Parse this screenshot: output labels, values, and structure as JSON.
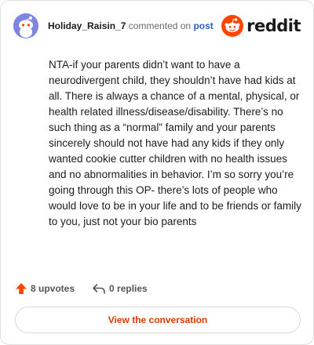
{
  "header": {
    "username": "Holiday_Raisin_7",
    "action_text": "commented on",
    "post_link": "post",
    "brand": "reddit"
  },
  "comment": {
    "body": "NTA-if your parents didn’t want to have a neurodivergent child, they shouldn’t have had kids at all. There is always a chance of a mental, physical, or health related illness/disease/disability. There’s no such thing as a “normal” family and your parents sincerely should not have had any kids if they only wanted cookie cutter children with no health issues and no abnormalities in behavior. I’m so sorry you’re going through this OP- there’s lots of people who would love to be in your life and to be friends or family to you, just not your bio parents"
  },
  "stats": {
    "upvotes": "8 upvotes",
    "replies": "0 replies"
  },
  "cta": {
    "label": "View the conversation"
  },
  "colors": {
    "accent": "#d93a00",
    "upvote": "#ff4500",
    "link": "#2e5fc7",
    "avatar": "#7e86e0"
  },
  "icons": {
    "upvote": "upvote-arrow-icon",
    "reply": "reply-arrow-icon",
    "brand": "reddit-snoo-icon",
    "avatar": "snoo-avatar-icon"
  }
}
